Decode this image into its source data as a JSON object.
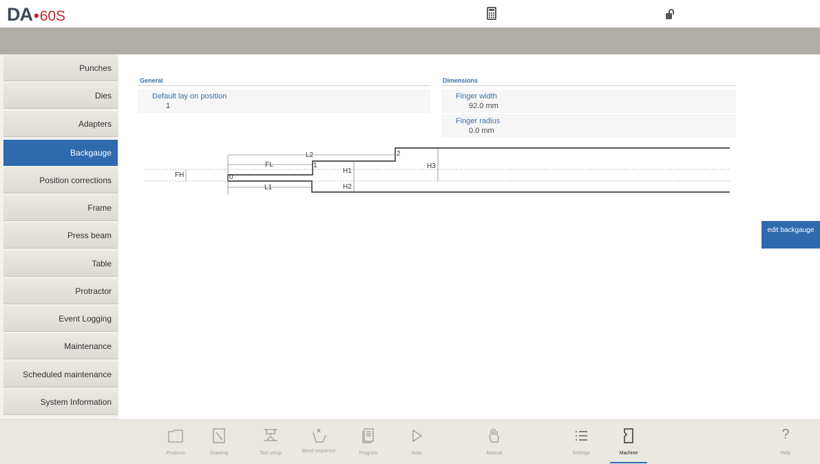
{
  "header": {
    "logo_brand": "DA",
    "logo_dot": "•",
    "logo_model": "60S",
    "icons": [
      "calculator-icon",
      "unlock-icon"
    ]
  },
  "sidebar": {
    "items": [
      {
        "label": "Punches"
      },
      {
        "label": "Dies"
      },
      {
        "label": "Adapters"
      },
      {
        "label": "Backgauge",
        "active": true
      },
      {
        "label": "Position corrections"
      },
      {
        "label": "Frame"
      },
      {
        "label": "Press beam"
      },
      {
        "label": "Table"
      },
      {
        "label": "Protractor"
      },
      {
        "label": "Event Logging"
      },
      {
        "label": "Maintenance"
      },
      {
        "label": "Scheduled maintenance"
      },
      {
        "label": "System Information"
      }
    ]
  },
  "general": {
    "title": "General",
    "default_lay_on_label": "Default lay on position",
    "default_lay_on_value": "1"
  },
  "dimensions": {
    "title": "Dimensions",
    "finger_width_label": "Finger width",
    "finger_width_value": "92.0 mm",
    "finger_radius_label": "Finger radius",
    "finger_radius_value": "0.0 mm"
  },
  "diagram": {
    "labels": {
      "L2": "L2",
      "FL": "FL",
      "L1": "L1",
      "FH": "FH",
      "H1": "H1",
      "H2": "H2",
      "H3": "H3",
      "p0": "0",
      "p1": "1",
      "p2": "2"
    }
  },
  "actions": {
    "edit_backgauge": "edit backgauge"
  },
  "bottom_nav": {
    "items": [
      {
        "label": "Products",
        "icon": "folder-icon"
      },
      {
        "label": "Drawing",
        "icon": "drawing-icon"
      },
      {
        "label": "Tool setup",
        "icon": "tool-setup-icon"
      },
      {
        "label": "Bend sequence",
        "icon": "bend-sequence-icon"
      },
      {
        "label": "Program",
        "icon": "program-icon"
      },
      {
        "label": "Auto",
        "icon": "play-icon"
      },
      {
        "label": "Manual",
        "icon": "hand-icon"
      },
      {
        "label": "Settings",
        "icon": "list-icon"
      },
      {
        "label": "Machine",
        "icon": "machine-icon",
        "active": true
      },
      {
        "label": "Help",
        "icon": "help-icon"
      }
    ]
  },
  "colors": {
    "accent": "#2e6aad",
    "logo_red": "#c0272d",
    "header_gray": "#afada6",
    "label_blue": "#3b6ea8"
  }
}
